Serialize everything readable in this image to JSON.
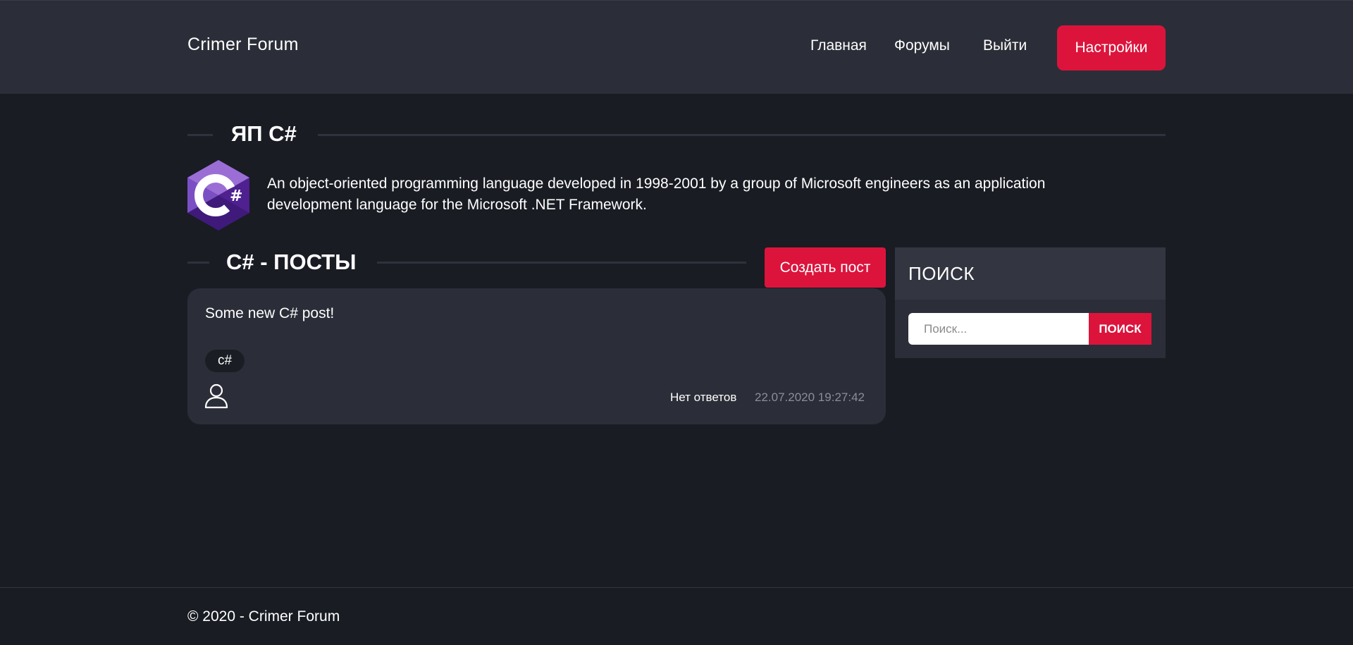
{
  "header": {
    "brand": "Crimer Forum",
    "nav": {
      "home": "Главная",
      "forums": "Форумы",
      "logout": "Выйти",
      "settings": "Настройки"
    }
  },
  "category": {
    "title": "ЯП C#",
    "logo_icon": "csharp-logo",
    "description": "An object-oriented programming language developed in 1998-2001 by a group of Microsoft engineers as an application development language for the Microsoft .NET Framework."
  },
  "posts": {
    "title": "C# - ПОСТЫ",
    "create_button": "Создать пост",
    "items": [
      {
        "title": "Some new C# post!",
        "tag": "c#",
        "avatar_icon": "user-icon",
        "replies": "Нет ответов",
        "date": "22.07.2020 19:27:42"
      }
    ]
  },
  "search": {
    "title": "ПОИСК",
    "placeholder": "Поиск...",
    "button": "ПОИСК"
  },
  "footer": {
    "text": "© 2020 - Crimer Forum"
  },
  "colors": {
    "accent": "#dc143c",
    "header_bg": "#2b2e38",
    "page_bg": "#191c23",
    "logo_light": "#9b6ed6",
    "logo_dark": "#3f1a7a"
  }
}
